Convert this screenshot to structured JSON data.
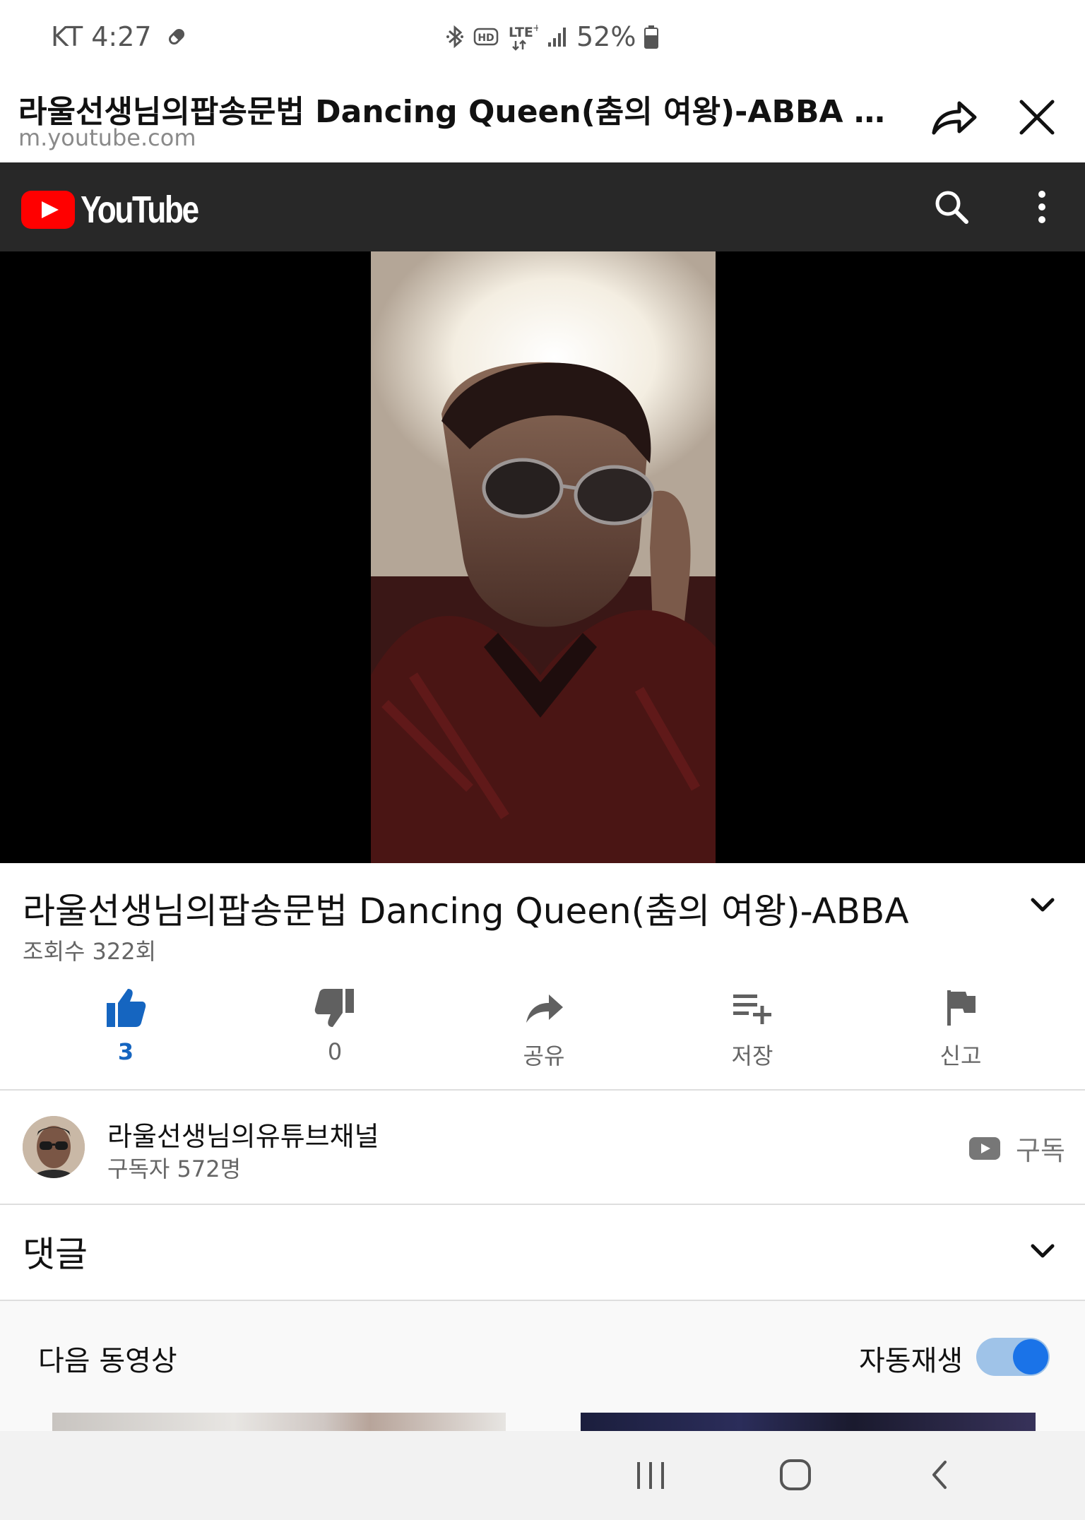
{
  "status_bar": {
    "carrier_time": "KT 4:27",
    "network": "LTE",
    "battery": "52%",
    "icons": [
      "pin-icon",
      "bluetooth-icon",
      "hd-icon",
      "lte-icon",
      "signal-icon",
      "battery-icon"
    ]
  },
  "tab_header": {
    "title": "라울선생님의팝송문법 Dancing Queen(춤의 여왕)-ABBA - You...",
    "url": "m.youtube.com",
    "icons": [
      "share-icon",
      "close-icon"
    ]
  },
  "youtube_bar": {
    "logo_text": "YouTube",
    "icons": [
      "search-icon",
      "more-vert-icon"
    ],
    "background": "#282828",
    "brand_color": "#ff0000"
  },
  "video": {
    "title": "라울선생님의팝송문법 Dancing Queen(춤의 여왕)-ABBA",
    "views": "조회수 322회"
  },
  "actions": [
    {
      "label": "3",
      "icon": "thumb-up-icon",
      "active": true
    },
    {
      "label": "0",
      "icon": "thumb-down-icon",
      "active": false
    },
    {
      "label": "공유",
      "icon": "share-arrow-icon",
      "active": false
    },
    {
      "label": "저장",
      "icon": "playlist-add-icon",
      "active": false
    },
    {
      "label": "신고",
      "icon": "flag-icon",
      "active": false
    }
  ],
  "channel": {
    "name": "라울선생님의유튜브채널",
    "subscribers": "구독자 572명",
    "subscribe_label": "구독"
  },
  "comments": {
    "label": "댓글"
  },
  "up_next": {
    "label": "다음 동영상",
    "autoplay_label": "자동재생",
    "autoplay_on": true,
    "accent": "#1a73e8"
  },
  "system_nav": {
    "icons": [
      "recents-icon",
      "home-icon",
      "back-icon"
    ]
  }
}
